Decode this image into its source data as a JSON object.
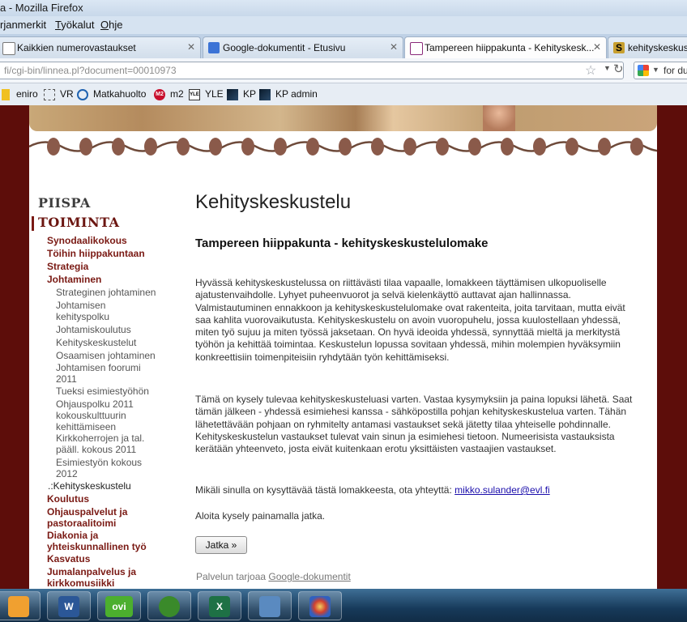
{
  "window": {
    "title": "a - Mozilla Firefox"
  },
  "menu": [
    {
      "label": "rjanmerkit",
      "ul": ""
    },
    {
      "label": "Työkalut",
      "ul": "T"
    },
    {
      "label": "Ohje",
      "ul": "O"
    }
  ],
  "tabs": [
    {
      "label": "Kaikkien numerovastaukset",
      "favicon": "spreadsheet-icon"
    },
    {
      "label": "Google-dokumentit - Etusivu",
      "favicon": "google-docs-icon"
    },
    {
      "label": "Tampereen hiippakunta - Kehityskesk...",
      "favicon": "church-icon",
      "active": true
    },
    {
      "label": "kehityskeskus",
      "favicon": "s-icon"
    }
  ],
  "address": {
    "url": "fi/cgi-bin/linnea.pl?document=00010973",
    "search_text": "for du"
  },
  "bookmarks": [
    {
      "label": "eniro",
      "icon": "eniro-icon"
    },
    {
      "label": "VR",
      "icon": "dotted-square-icon"
    },
    {
      "label": "Matkahuolto",
      "icon": "matkahuolto-icon"
    },
    {
      "label": "m2",
      "icon": "m2-icon",
      "badge": "M2"
    },
    {
      "label": "YLE",
      "icon": "yle-icon",
      "badge": "YLE"
    },
    {
      "label": "KP",
      "icon": "kp-icon"
    },
    {
      "label": "KP admin",
      "icon": "kp-admin-icon"
    }
  ],
  "sidebar": {
    "sections": [
      {
        "label": "PIISPA"
      },
      {
        "label": "TOIMINTA",
        "current": true
      }
    ],
    "items": [
      {
        "label": "Synodaalikokous"
      },
      {
        "label": "Töihin hiippakuntaan"
      },
      {
        "label": "Strategia"
      },
      {
        "label": "Johtaminen"
      },
      {
        "label": "Strateginen johtaminen"
      },
      {
        "label": "Johtamisen"
      },
      {
        "label": "kehityspolku"
      },
      {
        "label": "Johtamiskoulutus"
      },
      {
        "label": "Kehityskeskustelut"
      },
      {
        "label": "Osaamisen johtaminen"
      },
      {
        "label": "Johtamisen foorumi"
      },
      {
        "label": "2011"
      },
      {
        "label": "Tueksi esimiestyöhön"
      },
      {
        "label": "Ohjauspolku 2011"
      },
      {
        "label": "kokouskulttuurin"
      },
      {
        "label": "kehittämiseen"
      },
      {
        "label": "Kirkkoherrojen ja tal."
      },
      {
        "label": "pääll. kokous 2011"
      },
      {
        "label": "Esimiestyön kokous"
      },
      {
        "label": "2012"
      },
      {
        "label": ".:Kehityskeskustelu"
      },
      {
        "label": "Koulutus"
      },
      {
        "label": "Ohjauspalvelut ja"
      },
      {
        "label": "pastoraalitoimi"
      },
      {
        "label": "Diakonia ja"
      },
      {
        "label": "yhteiskunnallinen työ"
      },
      {
        "label": "Kasvatus"
      },
      {
        "label": "Jumalanpalvelus ja"
      },
      {
        "label": "kirkkomusiikki"
      }
    ]
  },
  "content": {
    "heading": "Kehityskeskustelu",
    "form_title": "Tampereen hiippakunta - kehityskeskustelulomake",
    "paragraph1": "Hyvässä kehityskeskustelussa on riittävästi tilaa vapaalle, lomakkeen täyttämisen ulkopuoliselle ajatustenvaihdolle. Lyhyet puheenvuorot ja selvä kielenkäyttö auttavat ajan hallinnassa. Valmistautuminen ennakkoon ja kehityskeskustelulomake ovat rakenteita, joita tarvitaan, mutta eivät saa kahlita vuorovaikutusta. Kehityskeskustelu on avoin vuoropuhelu, jossa kuulostellaan yhdessä, miten työ sujuu ja miten työssä jaksetaan. On hyvä ideoida yhdessä, synnyttää mieltä ja merkitystä työhön ja kehittää toimintaa. Keskustelun lopussa sovitaan yhdessä, mihin molempien hyväksymiin konkreettisiin toimenpiteisiin ryhdytään työn kehittämiseksi.",
    "paragraph2": "Tämä on kysely tulevaa kehityskeskusteluasi varten. Vastaa kysymyksiin ja paina lopuksi lähetä. Saat tämän jälkeen - yhdessä esimiehesi kanssa - sähköpostilla pohjan kehityskeskustelua varten. Tähän lähetettävään pohjaan on ryhmitelty antamasi vastaukset sekä jätetty tilaa yhteiselle pohdinnalle. Kehityskeskustelun vastaukset tulevat vain sinun ja esimiehesi tietoon. Numeerisista vastauksista kerätään yhteenveto, josta eivät kuitenkaan erotu yksittäisten vastaajien vastaukset.",
    "contact_prefix": "Mikäli sinulla on kysyttävää tästä lomakkeesta, ota yhteyttä: ",
    "contact_email": "mikko.sulander@evl.fi",
    "start_text": "Aloita kysely painamalla jatka.",
    "continue_button": "Jatka »",
    "footer_prefix": "Palvelun tarjoaa ",
    "footer_link": "Google-dokumentit"
  },
  "taskbar": [
    {
      "label": "",
      "icon": "outlook-icon"
    },
    {
      "label": "W",
      "icon": "word-icon"
    },
    {
      "label": "ovi",
      "icon": "ovi-icon"
    },
    {
      "label": "",
      "icon": "spotify-icon"
    },
    {
      "label": "X",
      "icon": "excel-icon"
    },
    {
      "label": "",
      "icon": "control-panel-icon"
    },
    {
      "label": "",
      "icon": "paint-icon"
    }
  ],
  "colors": {
    "accent": "#7a1a14",
    "background": "#5d0d0a",
    "link": "#1a0dab"
  }
}
